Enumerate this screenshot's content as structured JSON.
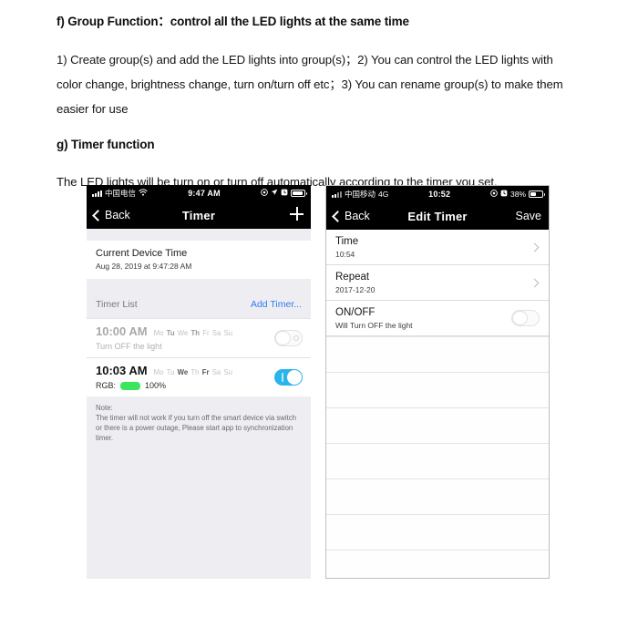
{
  "document": {
    "section_f": {
      "heading": "f) Group Function：control all the LED lights at the same time",
      "body": "1) Create group(s) and add the LED lights into group(s)；2) You can control the LED lights with color change, brightness change, turn on/turn off  etc；3) You can rename group(s) to make them easier for use"
    },
    "section_g": {
      "heading": "g) Timer function",
      "body": "The LED lights will be turn on or turn off automatically according to the timer you set."
    }
  },
  "phone_left": {
    "status_bar": {
      "carrier": "中国电信",
      "wifi_icon": "wifi-icon",
      "time": "9:47 AM",
      "icons": [
        "location-services-icon",
        "location-arrow-icon",
        "alarm-clock-icon",
        "battery-icon"
      ]
    },
    "nav": {
      "back_label": "Back",
      "back_icon": "chevron-left-icon",
      "title": "Timer",
      "add_icon": "plus-icon"
    },
    "device_time": {
      "title": "Current Device Time",
      "value": "Aug 28, 2019 at 9:47:28 AM"
    },
    "timer_list": {
      "label": "Timer List",
      "add_label": "Add Timer..."
    },
    "timers": [
      {
        "time": "10:00 AM",
        "enabled": false,
        "days": [
          {
            "label": "Mo",
            "active": false
          },
          {
            "label": "Tu",
            "active": true
          },
          {
            "label": "We",
            "active": false
          },
          {
            "label": "Th",
            "active": true
          },
          {
            "label": "Fr",
            "active": false
          },
          {
            "label": "Sa",
            "active": false
          },
          {
            "label": "Su",
            "active": false
          }
        ],
        "subtitle": "Turn OFF the light",
        "toggle_state": "off"
      },
      {
        "time": "10:03 AM",
        "enabled": true,
        "days": [
          {
            "label": "Mo",
            "active": false
          },
          {
            "label": "Tu",
            "active": false
          },
          {
            "label": "We",
            "active": true
          },
          {
            "label": "Th",
            "active": false
          },
          {
            "label": "Fr",
            "active": true
          },
          {
            "label": "Sa",
            "active": false
          },
          {
            "label": "Su",
            "active": false
          }
        ],
        "rgb_label": "RGB:",
        "rgb_color": "#3ce65c",
        "brightness": "100%",
        "toggle_state": "on"
      }
    ],
    "note": {
      "title": "Note:",
      "text": "The timer will not work if you turn off the smart device via switch or there is a power outage, Please start app to synchronization timer."
    }
  },
  "phone_right": {
    "status_bar": {
      "carrier": "中国移动",
      "network": "4G",
      "time": "10:52",
      "battery_percent": "38%",
      "icons": [
        "location-services-icon",
        "alarm-clock-icon",
        "battery-icon"
      ]
    },
    "nav": {
      "back_label": "Back",
      "back_icon": "chevron-left-icon",
      "title": "Edit Timer",
      "save_label": "Save"
    },
    "rows": [
      {
        "title": "Time",
        "sub": "10:54",
        "accessory": "chevron-right-icon"
      },
      {
        "title": "Repeat",
        "sub": "2017-12-20",
        "accessory": "chevron-right-icon"
      },
      {
        "title": "ON/OFF",
        "sub": "Will Turn OFF the light",
        "accessory": "toggle-off"
      }
    ],
    "empty_rows": 7
  },
  "colors": {
    "toggle_on": "#2ab4ec",
    "link": "#2f7bf6",
    "rgb_swatch": "#3ce65c",
    "panel_bg": "#eeeef2",
    "statusbar_bg": "#000000"
  }
}
